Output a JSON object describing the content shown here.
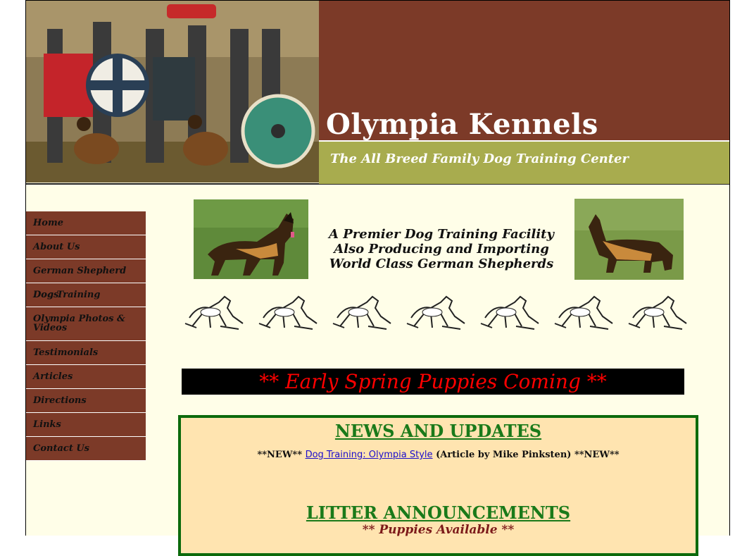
{
  "header": {
    "title": "Olympia Kennels",
    "tagline": "The All Breed Family Dog Training Center"
  },
  "nav": {
    "items": [
      {
        "label": "Home"
      },
      {
        "label": "About Us"
      },
      {
        "label": "German Shepherd Dogs"
      },
      {
        "label": "Dog Training"
      },
      {
        "label": "Olympia Photos & Videos"
      },
      {
        "label": "Testimonials"
      },
      {
        "label": "Articles"
      },
      {
        "label": "Directions"
      },
      {
        "label": "Links"
      },
      {
        "label": "Contact Us"
      }
    ]
  },
  "intro": {
    "line1": "A Premier Dog Training Facility",
    "line2": "Also Producing and Importing",
    "line3": "World Class German Shepherds"
  },
  "banner": {
    "text": "** Early Spring Puppies Coming **"
  },
  "news": {
    "title": "NEWS AND UPDATES",
    "prefix": "**NEW**",
    "link_text": "Dog Training: Olympia Style",
    "suffix": "(Article by Mike Pinksten) **NEW**",
    "litter_title": "LITTER ANNOUNCEMENTS",
    "puppies_prefix": "** ",
    "puppies_text": "Puppies Available",
    "puppies_suffix": " **"
  },
  "colors": {
    "brown": "#7c3a28",
    "olive": "#a8ac4e",
    "banner_red": "#ff0000",
    "news_green": "#1a7a1a",
    "news_bg": "#ffe4b0"
  }
}
